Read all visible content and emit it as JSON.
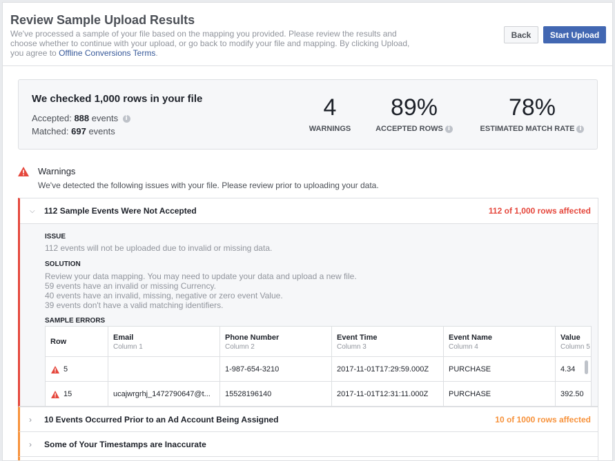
{
  "header": {
    "title": "Review Sample Upload Results",
    "subtitle": "We've processed a sample of your file based on the mapping you provided. Please review the results and choose whether to continue with your upload, or go back to modify your file and mapping. By clicking Upload, you agree to",
    "terms_link": "Offline Conversions Terms",
    "terms_suffix": ".",
    "back_label": "Back",
    "start_label": "Start Upload"
  },
  "summary": {
    "title": "We checked 1,000 rows in your file",
    "accepted_label": "Accepted:",
    "accepted_value": "888",
    "accepted_unit": "events",
    "matched_label": "Matched:",
    "matched_value": "697",
    "matched_unit": "events",
    "metrics": [
      {
        "value": "4",
        "label": "WARNINGS"
      },
      {
        "value": "89%",
        "label": "ACCEPTED ROWS"
      },
      {
        "value": "78%",
        "label": "ESTIMATED MATCH RATE"
      }
    ]
  },
  "warnings": {
    "title": "Warnings",
    "description": "We've detected the following issues with your file. Please review prior to uploading your data.",
    "items": [
      {
        "title": "112 Sample Events Were Not Accepted",
        "affected": "112 of 1,000 rows affected",
        "issue_label": "ISSUE",
        "issue_text": "112 events will not be uploaded due to invalid or missing data.",
        "solution_label": "SOLUTION",
        "solution_lines": [
          "Review your data mapping. You may need to update your data and upload a new file.",
          "59 events have an invalid or missing Currency.",
          "40 events have an invalid, missing, negative or zero event Value.",
          "39 events don't have a valid matching identifiers."
        ],
        "sample_label": "SAMPLE ERRORS",
        "columns": [
          {
            "name": "Row",
            "sub": ""
          },
          {
            "name": "Email",
            "sub": "Column 1"
          },
          {
            "name": "Phone Number",
            "sub": "Column 2"
          },
          {
            "name": "Event Time",
            "sub": "Column 3"
          },
          {
            "name": "Event Name",
            "sub": "Column 4"
          },
          {
            "name": "Value",
            "sub": "Column 5"
          }
        ],
        "rows": [
          {
            "row": "5",
            "email": "",
            "phone": "1-987-654-3210",
            "time": "2017-11-01T17:29:59.000Z",
            "event": "PURCHASE",
            "value": "4.34"
          },
          {
            "row": "15",
            "email": "ucajwrgrhj_1472790647@t...",
            "phone": "15528196140",
            "time": "2017-11-01T12:31:11.000Z",
            "event": "PURCHASE",
            "value": "392.50"
          }
        ]
      },
      {
        "title": "10 Events Occurred Prior to an Ad Account Being Assigned",
        "affected": "10 of 1000 rows affected"
      },
      {
        "title": "Some of Your Timestamps are Inaccurate",
        "affected": ""
      }
    ]
  },
  "colors": {
    "primary": "#4267b2",
    "link": "#365899",
    "error": "#e5473c",
    "warning": "#f7923b"
  }
}
